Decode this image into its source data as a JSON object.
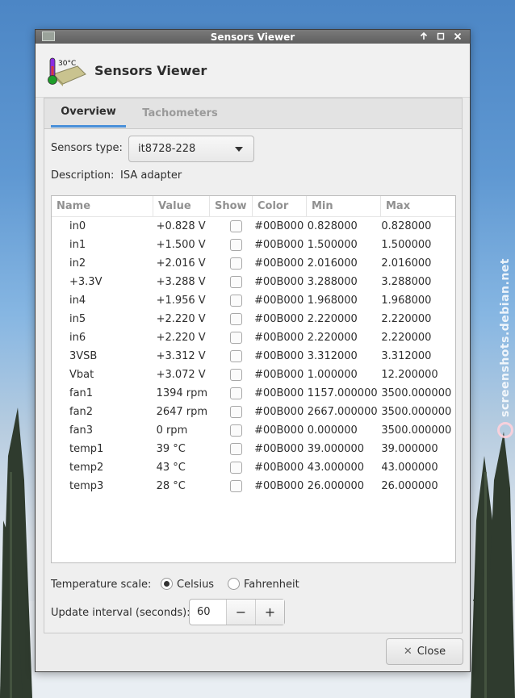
{
  "window": {
    "title": "Sensors Viewer",
    "controls": [
      "maximize-up",
      "restore",
      "close"
    ]
  },
  "header": {
    "logo_text": "30°C",
    "title": "Sensors Viewer"
  },
  "tabs": [
    {
      "label": "Overview",
      "active": true
    },
    {
      "label": "Tachometers",
      "active": false
    }
  ],
  "sensors": {
    "type_label": "Sensors type:",
    "type_value": "it8728-228",
    "description_label": "Description:",
    "description_value": "ISA adapter"
  },
  "table": {
    "columns": [
      "Name",
      "Value",
      "Show",
      "Color",
      "Min",
      "Max"
    ],
    "rows": [
      {
        "name": "in0",
        "value": "+0.828 V",
        "show": false,
        "color": "#00B000",
        "min": "0.828000",
        "max": "0.828000"
      },
      {
        "name": "in1",
        "value": "+1.500 V",
        "show": false,
        "color": "#00B000",
        "min": "1.500000",
        "max": "1.500000"
      },
      {
        "name": "in2",
        "value": "+2.016 V",
        "show": false,
        "color": "#00B000",
        "min": "2.016000",
        "max": "2.016000"
      },
      {
        "name": "+3.3V",
        "value": "+3.288 V",
        "show": false,
        "color": "#00B000",
        "min": "3.288000",
        "max": "3.288000"
      },
      {
        "name": "in4",
        "value": "+1.956 V",
        "show": false,
        "color": "#00B000",
        "min": "1.968000",
        "max": "1.968000"
      },
      {
        "name": "in5",
        "value": "+2.220 V",
        "show": false,
        "color": "#00B000",
        "min": "2.220000",
        "max": "2.220000"
      },
      {
        "name": "in6",
        "value": "+2.220 V",
        "show": false,
        "color": "#00B000",
        "min": "2.220000",
        "max": "2.220000"
      },
      {
        "name": "3VSB",
        "value": "+3.312 V",
        "show": false,
        "color": "#00B000",
        "min": "3.312000",
        "max": "3.312000"
      },
      {
        "name": "Vbat",
        "value": "+3.072 V",
        "show": false,
        "color": "#00B000",
        "min": "1.000000",
        "max": "12.200000"
      },
      {
        "name": "fan1",
        "value": "1394 rpm",
        "show": false,
        "color": "#00B000",
        "min": "1157.000000",
        "max": "3500.000000"
      },
      {
        "name": "fan2",
        "value": "2647 rpm",
        "show": false,
        "color": "#00B000",
        "min": "2667.000000",
        "max": "3500.000000"
      },
      {
        "name": "fan3",
        "value": "0 rpm",
        "show": false,
        "color": "#00B000",
        "min": "0.000000",
        "max": "3500.000000"
      },
      {
        "name": "temp1",
        "value": "39 °C",
        "show": false,
        "color": "#00B000",
        "min": "39.000000",
        "max": "39.000000"
      },
      {
        "name": "temp2",
        "value": "43 °C",
        "show": false,
        "color": "#00B000",
        "min": "43.000000",
        "max": "43.000000"
      },
      {
        "name": "temp3",
        "value": "28 °C",
        "show": false,
        "color": "#00B000",
        "min": "26.000000",
        "max": "26.000000"
      }
    ]
  },
  "temperature": {
    "label": "Temperature scale:",
    "options": [
      "Celsius",
      "Fahrenheit"
    ],
    "selected": "Celsius"
  },
  "update": {
    "label": "Update interval (seconds):",
    "value": "60",
    "minus": "−",
    "plus": "+"
  },
  "footer": {
    "close_label": "Close"
  },
  "desktop": {
    "watermark": "screenshots.debian.net"
  },
  "colors": {
    "accent": "#4a90d9",
    "titlebar": "#6b6b6b",
    "window_bg": "#ececec"
  }
}
